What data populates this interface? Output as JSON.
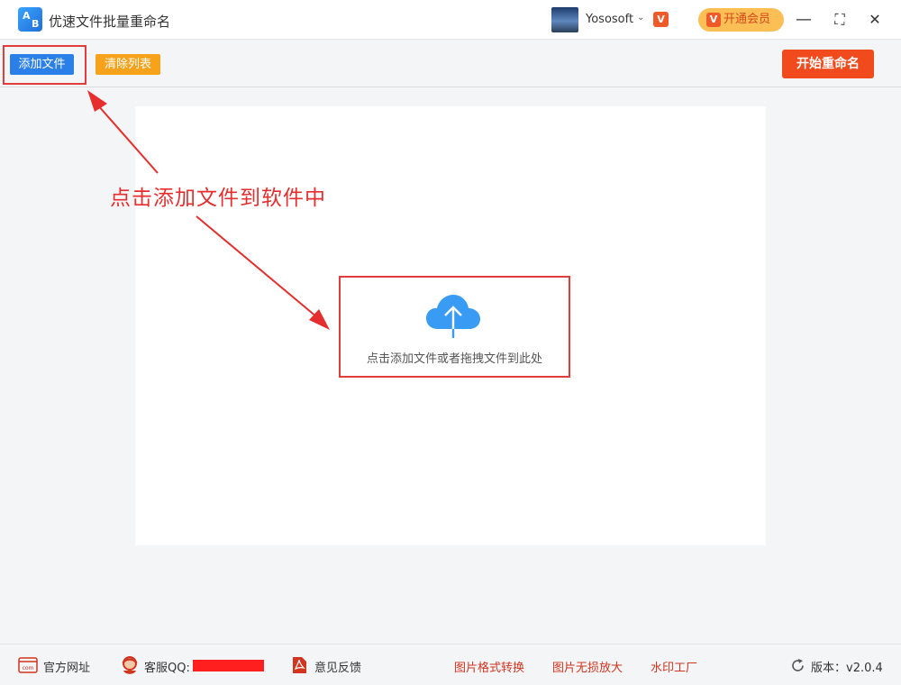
{
  "app": {
    "title": "优速文件批量重命名",
    "logo_letters": [
      "A",
      "B"
    ]
  },
  "user": {
    "name": "Yososoft",
    "vip_badge": "V",
    "vip_button_label": "开通会员"
  },
  "window_controls": {
    "minimize": "—",
    "maximize": "⛶",
    "close": "✕"
  },
  "toolbar": {
    "add_files_label": "添加文件",
    "clear_list_label": "清除列表",
    "start_rename_label": "开始重命名"
  },
  "drop_area": {
    "hint_text": "点击添加文件或者拖拽文件到此处"
  },
  "annotation": {
    "callout_text": "点击添加文件到软件中"
  },
  "footer": {
    "website_label": "官方网址",
    "website_icon_text": "com",
    "support_label": "客服QQ:",
    "feedback_label": "意见反馈",
    "links": [
      "图片格式转换",
      "图片无损放大",
      "水印工厂"
    ],
    "version_label": "版本：v2.0.4"
  },
  "colors": {
    "add_button": "#2b7fe8",
    "clear_button": "#f7a21b",
    "start_button": "#f04a1d",
    "annotation_red": "#e62e2e",
    "cloud_blue": "#3a9bf5"
  }
}
